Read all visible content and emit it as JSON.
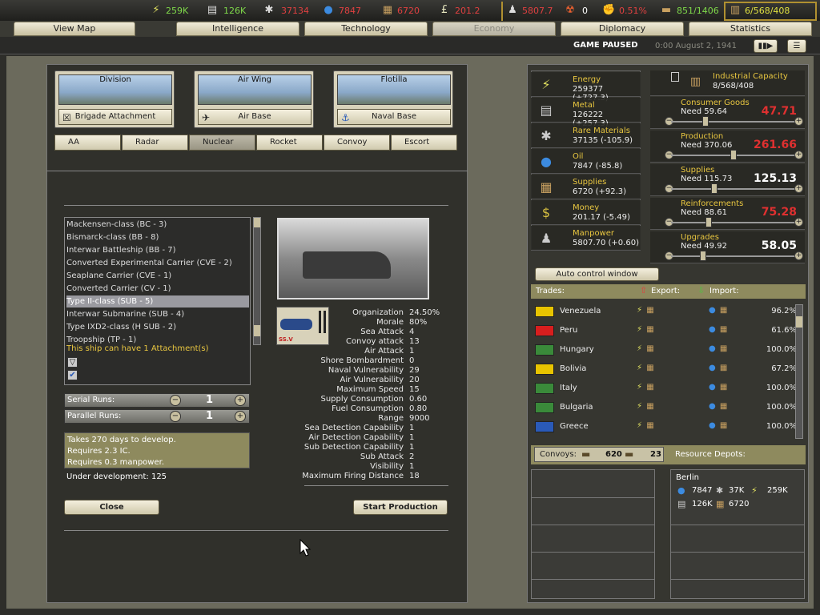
{
  "topbar": {
    "energy": "259K",
    "metal": "126K",
    "rare": "37134",
    "oil": "7847",
    "supplies": "6720",
    "money": "201.2",
    "manpower": "5807.7",
    "nukes": "0",
    "dissent": "0.51%",
    "transport": "851/1406",
    "ic": "6/568/408"
  },
  "nav": {
    "tabs": [
      "View Map",
      "Intelligence",
      "Technology",
      "Economy",
      "Diplomacy",
      "Statistics"
    ]
  },
  "status": {
    "paused": "GAME PAUSED",
    "date": "0:00 August 2, 1941"
  },
  "units": {
    "division": "Division",
    "airwing": "Air Wing",
    "flotilla": "Flotilla",
    "brigade": "Brigade Attachment",
    "airbase": "Air Base",
    "navalbase": "Naval Base"
  },
  "subtabs": [
    "AA",
    "Radar",
    "Nuclear",
    "Rocket",
    "Convoy",
    "Escort"
  ],
  "ships": [
    "Mackensen-class (BC - 3)",
    "Bismarck-class (BB - 8)",
    "Interwar Battleship (BB - 7)",
    "Converted Experimental Carrier (CVE - 2)",
    "Seaplane Carrier (CVE - 1)",
    "Converted Carrier (CV - 1)",
    "Type II-class (SUB - 5)",
    "Interwar Submarine (SUB - 4)",
    "Type IXD2-class (H SUB - 2)",
    "Troopship (TP - 1)"
  ],
  "attach_note": "This ship can have 1 Attachment(s)",
  "runs": {
    "serial_label": "Serial Runs:",
    "serial": "1",
    "parallel_label": "Parallel Runs:",
    "parallel": "1"
  },
  "info": {
    "l1": "Takes 270 days to develop.",
    "l2": "Requires 2.3 IC.",
    "l3": "Requires 0.3 manpower.",
    "dev": "Under development: 125"
  },
  "ship_tag": "SS.V",
  "stats": [
    [
      "Organization",
      "24.50%"
    ],
    [
      "Morale",
      "80%"
    ],
    [
      "Sea Attack",
      "4"
    ],
    [
      "Convoy attack",
      "13"
    ],
    [
      "Air Attack",
      "1"
    ],
    [
      "Shore Bombardment",
      "0"
    ],
    [
      "Naval Vulnerability",
      "29"
    ],
    [
      "Air Vulnerability",
      "20"
    ],
    [
      "Maximum Speed",
      "15"
    ],
    [
      "Supply Consumption",
      "0.60"
    ],
    [
      "Fuel Consumption",
      "0.80"
    ],
    [
      "Range",
      "9000"
    ],
    [
      "Sea Detection Capability",
      "1"
    ],
    [
      "Air Detection Capability",
      "1"
    ],
    [
      "Sub Detection Capability",
      "1"
    ],
    [
      "Sub Attack",
      "2"
    ],
    [
      "Visibility",
      "1"
    ],
    [
      "Maximum Firing Distance",
      "18"
    ]
  ],
  "buttons": {
    "close": "Close",
    "start": "Start Production",
    "auto": "Auto control window"
  },
  "resources": [
    {
      "name": "Energy",
      "value": "259377 (+727.3)",
      "icon": "energy-icon"
    },
    {
      "name": "Metal",
      "value": "126222 (+257.3)",
      "icon": "metal-icon"
    },
    {
      "name": "Rare Materials",
      "value": "37135 (-105.9)",
      "icon": "rare-materials-icon"
    },
    {
      "name": "Oil",
      "value": "7847 (-85.8)",
      "icon": "oil-icon"
    },
    {
      "name": "Supplies",
      "value": "6720 (+92.3)",
      "icon": "supplies-icon"
    },
    {
      "name": "Money",
      "value": "201.17 (-5.49)",
      "icon": "money-icon"
    },
    {
      "name": "Manpower",
      "value": "5807.70 (+0.60)",
      "icon": "manpower-icon"
    }
  ],
  "ic": {
    "title": "Industrial Capacity",
    "value": "8/568/408"
  },
  "sliders": [
    {
      "name": "Consumer Goods",
      "need": "Need 59.64",
      "big": "47.71",
      "color": "#e03030",
      "pos": 0.22
    },
    {
      "name": "Production",
      "need": "Need 370.06",
      "big": "261.66",
      "color": "#e03030",
      "pos": 0.47
    },
    {
      "name": "Supplies",
      "need": "Need 115.73",
      "big": "125.13",
      "color": "#ffffff",
      "pos": 0.3
    },
    {
      "name": "Reinforcements",
      "need": "Need 88.61",
      "big": "75.28",
      "color": "#e03030",
      "pos": 0.25
    },
    {
      "name": "Upgrades",
      "need": "Need 49.92",
      "big": "58.05",
      "color": "#ffffff",
      "pos": 0.2
    }
  ],
  "trades_header": {
    "trades": "Trades:",
    "export": "Export:",
    "import": "Import:"
  },
  "trades": [
    {
      "country": "Venezuela",
      "pct": "96.2%",
      "flag": "#e8c400"
    },
    {
      "country": "Peru",
      "pct": "61.6%",
      "flag": "#d81e1e"
    },
    {
      "country": "Hungary",
      "pct": "100.0%",
      "flag": "#3a8a3a"
    },
    {
      "country": "Bolivia",
      "pct": "67.2%",
      "flag": "#e8c400"
    },
    {
      "country": "Italy",
      "pct": "100.0%",
      "flag": "#3a8a3a"
    },
    {
      "country": "Bulgaria",
      "pct": "100.0%",
      "flag": "#3a8a3a"
    },
    {
      "country": "Greece",
      "pct": "100.0%",
      "flag": "#2a5ab8"
    }
  ],
  "convoys": {
    "label": "Convoys:",
    "a": "620",
    "b": "23",
    "depots": "Resource Depots:"
  },
  "depot": {
    "city": "Berlin",
    "oil": "7847",
    "rare": "37K",
    "energy": "259K",
    "metal": "126K",
    "supplies": "6720"
  }
}
